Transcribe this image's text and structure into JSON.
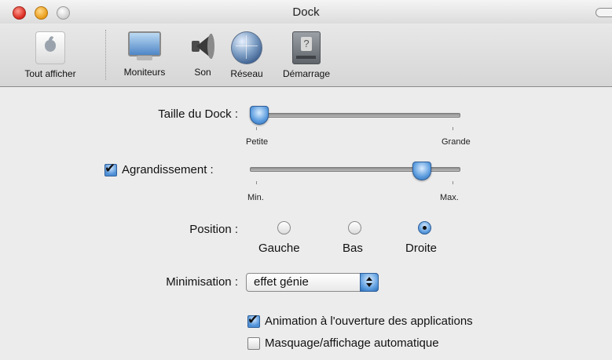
{
  "window": {
    "title": "Dock"
  },
  "toolbar": {
    "items": [
      {
        "label": "Tout afficher",
        "icon": "apple-icon"
      },
      {
        "label": "Moniteurs",
        "icon": "monitor-icon"
      },
      {
        "label": "Son",
        "icon": "speaker-icon"
      },
      {
        "label": "Réseau",
        "icon": "network-globe-icon"
      },
      {
        "label": "Démarrage",
        "icon": "startup-disk-icon"
      }
    ]
  },
  "dock_size": {
    "label": "Taille du Dock :",
    "min_label": "Petite",
    "max_label": "Grande",
    "value_fraction": 0.0
  },
  "magnification": {
    "label": "Agrandissement :",
    "checked": true,
    "min_label": "Min.",
    "max_label": "Max.",
    "value_fraction": 0.85
  },
  "position": {
    "label": "Position :",
    "options": [
      {
        "label": "Gauche",
        "selected": false
      },
      {
        "label": "Bas",
        "selected": false
      },
      {
        "label": "Droite",
        "selected": true
      }
    ]
  },
  "minimize": {
    "label": "Minimisation :",
    "value": "effet génie"
  },
  "options": {
    "animate_label": "Animation à l'ouverture des applications",
    "animate_checked": true,
    "autohide_label": "Masquage/affichage automatique",
    "autohide_checked": false
  },
  "colors": {
    "accent": "#4d8fd6"
  }
}
